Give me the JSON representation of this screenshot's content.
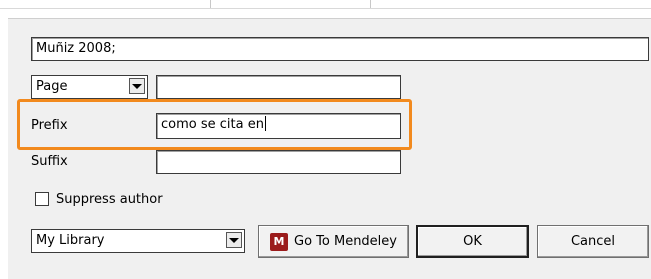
{
  "citation": {
    "value": "Muñiz 2008;"
  },
  "locator": {
    "selected": "Page",
    "value": ""
  },
  "prefix": {
    "label": "Prefix",
    "value": "como se cita en"
  },
  "suffix": {
    "label": "Suffix",
    "value": ""
  },
  "suppress_author": {
    "label": "Suppress author",
    "checked": false
  },
  "library": {
    "selected": "My Library"
  },
  "buttons": {
    "go_to_mendeley": "Go To Mendeley",
    "ok": "OK",
    "cancel": "Cancel"
  },
  "colors": {
    "highlight": "#f28a1e",
    "mendeley_brand": "#9b1c1c"
  },
  "icons": {
    "mendeley": "mendeley-logo-icon",
    "dropdown": "chevron-down-icon"
  }
}
